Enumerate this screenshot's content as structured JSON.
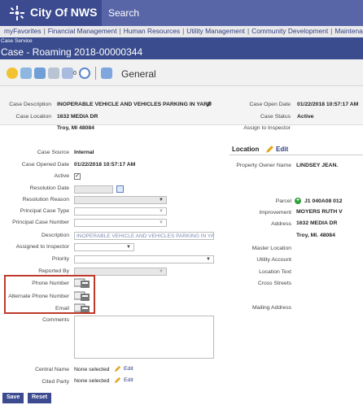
{
  "app": {
    "title": "City Of NWS",
    "search_placeholder": "Search"
  },
  "nav": {
    "items": [
      "myFavorites",
      "Financial Management",
      "Human Resources",
      "Utility Management",
      "Community Development",
      "Maintenance"
    ],
    "separator": "|"
  },
  "case": {
    "type_label": "Case Service",
    "title": "Case - Roaming 2018-00000344"
  },
  "toolbar": {
    "badge": "0",
    "section": "General"
  },
  "summary": {
    "description_label": "Case Description",
    "description": "INOPERABLE VEHICLE AND VEHICLES PARKING IN YARD",
    "location_label": "Case Location",
    "location_line1": "1632 MEDIA DR",
    "location_line2": "Troy, MI 48084",
    "open_date_label": "Case Open Date",
    "open_date": "01/22/2018 10:57:17 AM",
    "status_label": "Case Status",
    "status": "Active",
    "assign_label": "Assign to Inspector"
  },
  "form": {
    "case_source_label": "Case Source",
    "case_source": "Internal",
    "opened_date_label": "Case Opened Date",
    "opened_date": "01/22/2018 10:57:17 AM",
    "active_label": "Active",
    "active_mark": "✓",
    "resolution_date_label": "Resolution Date",
    "resolution_reason_label": "Resolution Reason",
    "principal_type_label": "Principal Case Type",
    "principal_number_label": "Principal Case Number",
    "description_label": "Description",
    "description": "INOPERABLE VEHICLE AND VEHICLES PARKING IN YARD",
    "assigned_label": "Assigned to Inspector",
    "priority_label": "Priority",
    "reported_by_label": "Reported By",
    "phone_label": "Phone Number",
    "alt_phone_label": "Alternate Phone Number",
    "email_label": "Email",
    "comments_label": "Comments",
    "central_name_label": "Central Name",
    "central_name": "None selected",
    "cited_party_label": "Cited Party",
    "cited_party": "None selected",
    "edit": "Edit"
  },
  "location": {
    "title": "Location",
    "edit": "Edit",
    "owner_label": "Property Owner Name",
    "owner": "LINDSEY JEAN.",
    "parcel_label": "Parcel",
    "parcel": "J1 040A08 012",
    "improvement_label": "Improvement",
    "improvement": "MOYERS RUTH V",
    "address_label": "Address",
    "address_line1": "1632 MEDIA DR",
    "address_line2": "Troy, MI. 48084",
    "master_label": "Master Location",
    "utility_label": "Utility Account",
    "location_text_label": "Location Text",
    "cross_label": "Cross Streets",
    "mailing_label": "Mailing Address"
  },
  "buttons": {
    "save": "Save",
    "reset": "Reset"
  },
  "colors": {
    "brand": "#3c4a8f",
    "highlight": "#c0392b"
  }
}
